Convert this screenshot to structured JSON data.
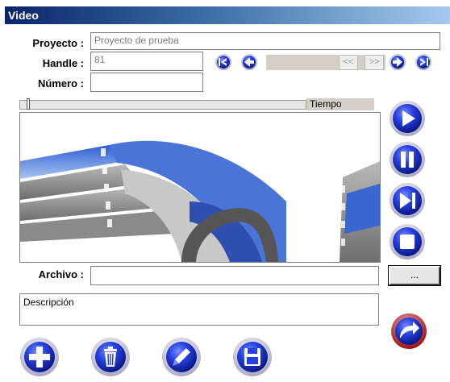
{
  "window": {
    "title": "Video"
  },
  "form": {
    "proyecto_label": "Proyecto :",
    "proyecto_value": "Proyecto de prueba",
    "handle_label": "Handle :",
    "handle_value": "81",
    "numero_label": "Número :",
    "numero_value": "",
    "archivo_label": "Archivo :",
    "archivo_value": "",
    "descripcion_placeholder": "Descripción"
  },
  "navigation": {
    "first_icon": "first-record-icon",
    "prev_icon": "previous-record-icon",
    "prev_small_label": "<<",
    "next_small_label": ">>",
    "next_icon": "next-record-icon",
    "last_icon": "last-record-icon"
  },
  "player": {
    "time_label": "Tiempo",
    "position_fraction": 0.02,
    "controls": [
      "play-icon",
      "pause-icon",
      "step-forward-icon",
      "stop-icon"
    ]
  },
  "buttons": {
    "browse_label": "...",
    "actions": [
      "add-icon",
      "trash-icon",
      "pen-icon",
      "floppy-disk-icon"
    ],
    "exit_icon": "curved-arrow-icon"
  },
  "colors": {
    "titlebar_start": "#0a246a",
    "titlebar_end": "#a6caf0",
    "button_blue": "#1530c8",
    "button_ring": "#e2e2f0",
    "exit_ring": "#b01818"
  }
}
